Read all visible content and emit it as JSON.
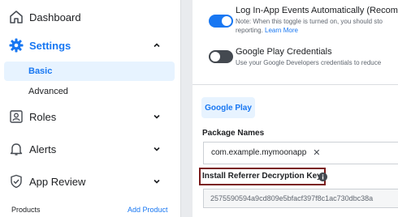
{
  "sidebar": {
    "items": [
      {
        "label": "Dashboard",
        "icon": "home-icon"
      },
      {
        "label": "Settings",
        "icon": "gear-icon",
        "active": true
      },
      {
        "label": "Roles",
        "icon": "roles-icon"
      },
      {
        "label": "Alerts",
        "icon": "bell-icon"
      },
      {
        "label": "App Review",
        "icon": "check-shield-icon"
      }
    ],
    "settings_sub": [
      {
        "label": "Basic",
        "active": true
      },
      {
        "label": "Advanced"
      }
    ],
    "products_label": "Products",
    "add_product_label": "Add Product"
  },
  "main": {
    "log_events": {
      "title": "Log In-App Events Automatically (Recomme",
      "note_line1": "Note: When this toggle is turned on, you should sto",
      "note_line2": "reporting.",
      "learn_more": "Learn More",
      "toggle_on": true
    },
    "google_play_credentials": {
      "title": "Google Play Credentials",
      "note": "Use your Google Developers credentials to reduce",
      "toggle_on": false
    },
    "tab_label": "Google Play",
    "package_names": {
      "label": "Package Names",
      "chip": "com.example.mymoonapp",
      "remove_glyph": "✕"
    },
    "referrer_key": {
      "label": "Install Referrer Decryption Key",
      "value": "2575590594a9cd809e5bfacf397f8c1ac730dbc38a"
    }
  },
  "colors": {
    "accent": "#1877f2",
    "highlight_box": "#7a1a1a",
    "active_bg": "#e7f3ff"
  }
}
